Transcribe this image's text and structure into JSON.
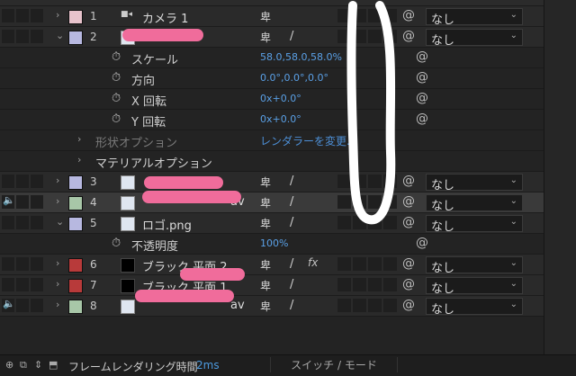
{
  "layers": [
    {
      "num": "1",
      "name": "カメラ 1",
      "color": "#e8c3cc",
      "icon": "camera-icon",
      "expanded": false,
      "has_pen": false,
      "dropdown": "なし"
    },
    {
      "num": "2",
      "name": "",
      "color": "#b7b8e0",
      "icon": "light-icon",
      "expanded": true,
      "has_pen": true,
      "dropdown": "なし"
    },
    {
      "num": "3",
      "name": "",
      "color": "#b7b8e0",
      "icon": "file-icon",
      "expanded": false,
      "has_pen": true,
      "dropdown": "なし"
    },
    {
      "num": "4",
      "name": "av",
      "color": "#a8c7a8",
      "icon": "audio-icon",
      "expanded": false,
      "has_pen": true,
      "dropdown": "なし"
    },
    {
      "num": "5",
      "name": "ロゴ.png",
      "color": "#b7b8e0",
      "icon": "image-icon",
      "expanded": true,
      "has_pen": true,
      "dropdown": "なし"
    },
    {
      "num": "6",
      "name": "ブラック 平面 2",
      "color": "#b83a3a",
      "icon": "solid-icon",
      "expanded": false,
      "has_pen": true,
      "dropdown": "なし"
    },
    {
      "num": "7",
      "name": "ブラック 平面 1",
      "color": "#b83a3a",
      "icon": "solid-icon",
      "expanded": false,
      "has_pen": true,
      "dropdown": "なし"
    },
    {
      "num": "8",
      "name": "av",
      "color": "#a8c7a8",
      "icon": "audio-icon",
      "expanded": false,
      "has_pen": true,
      "dropdown": "なし"
    }
  ],
  "properties_layer2": [
    {
      "name": "スケール",
      "value": "58.0,58.0,58.0%"
    },
    {
      "name": "方向",
      "value": "0.0°,0.0°,0.0°"
    },
    {
      "name": "X 回転",
      "value": "0x+0.0°"
    },
    {
      "name": "Y 回転",
      "value": "0x+0.0°"
    }
  ],
  "groups": {
    "shape_options": "形状オプション",
    "renderer_link": "レンダラーを変更...",
    "material_options": "マテリアルオプション"
  },
  "opacity_prop": {
    "name": "不透明度",
    "value": "100%"
  },
  "shy_glyph": "卑",
  "pen_glyph": "/",
  "fx_glyph": "fx",
  "spiral_glyph": "@",
  "dropdown_chevron": "⌄",
  "bottom_bar": {
    "label": "フレームレンダリング時間",
    "value": "2ms",
    "toggle": "スイッチ / モード"
  },
  "colors": {
    "value_blue": "#5aa0e6",
    "redact_pink": "#f06c9b",
    "highlight_ring": "#ffffff"
  }
}
